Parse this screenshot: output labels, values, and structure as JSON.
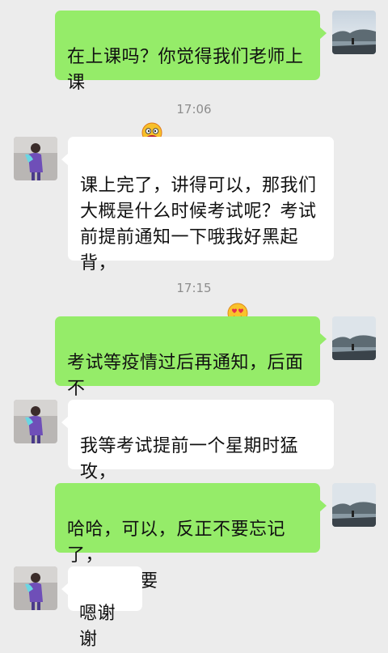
{
  "messages": [
    {
      "side": "right",
      "text": "在上课吗？你觉得我们老师上课\n怎么样啊",
      "emoji": "smirk-emoji"
    },
    {
      "side": "left",
      "text": "课上完了，讲得可以，那我们\n大概是什么时候考试呢？考试\n前提前通知一下哦我好黑起背，\n背早了怕又忘了！",
      "emoji": "heart-eyes-emoji"
    },
    {
      "side": "right",
      "text": "考试等疫情过后再通知，后面不\n上课了，也要记得多复习哦"
    },
    {
      "side": "left",
      "text": "我等考试提前一个星期时猛攻，\n怕忘了"
    },
    {
      "side": "right",
      "text": "哈哈，可以，反正不要忘记了，\n复习很重要"
    },
    {
      "side": "left",
      "text": "嗯谢谢"
    }
  ],
  "timestamps": [
    "17:06",
    "17:15"
  ],
  "colors": {
    "background": "#ececec",
    "bubble_sent": "#95ec69",
    "bubble_received": "#ffffff",
    "timestamp": "#8d8d8d"
  },
  "icons": {
    "sender_avatar": "landscape-avatar",
    "receiver_avatar": "person-avatar"
  }
}
